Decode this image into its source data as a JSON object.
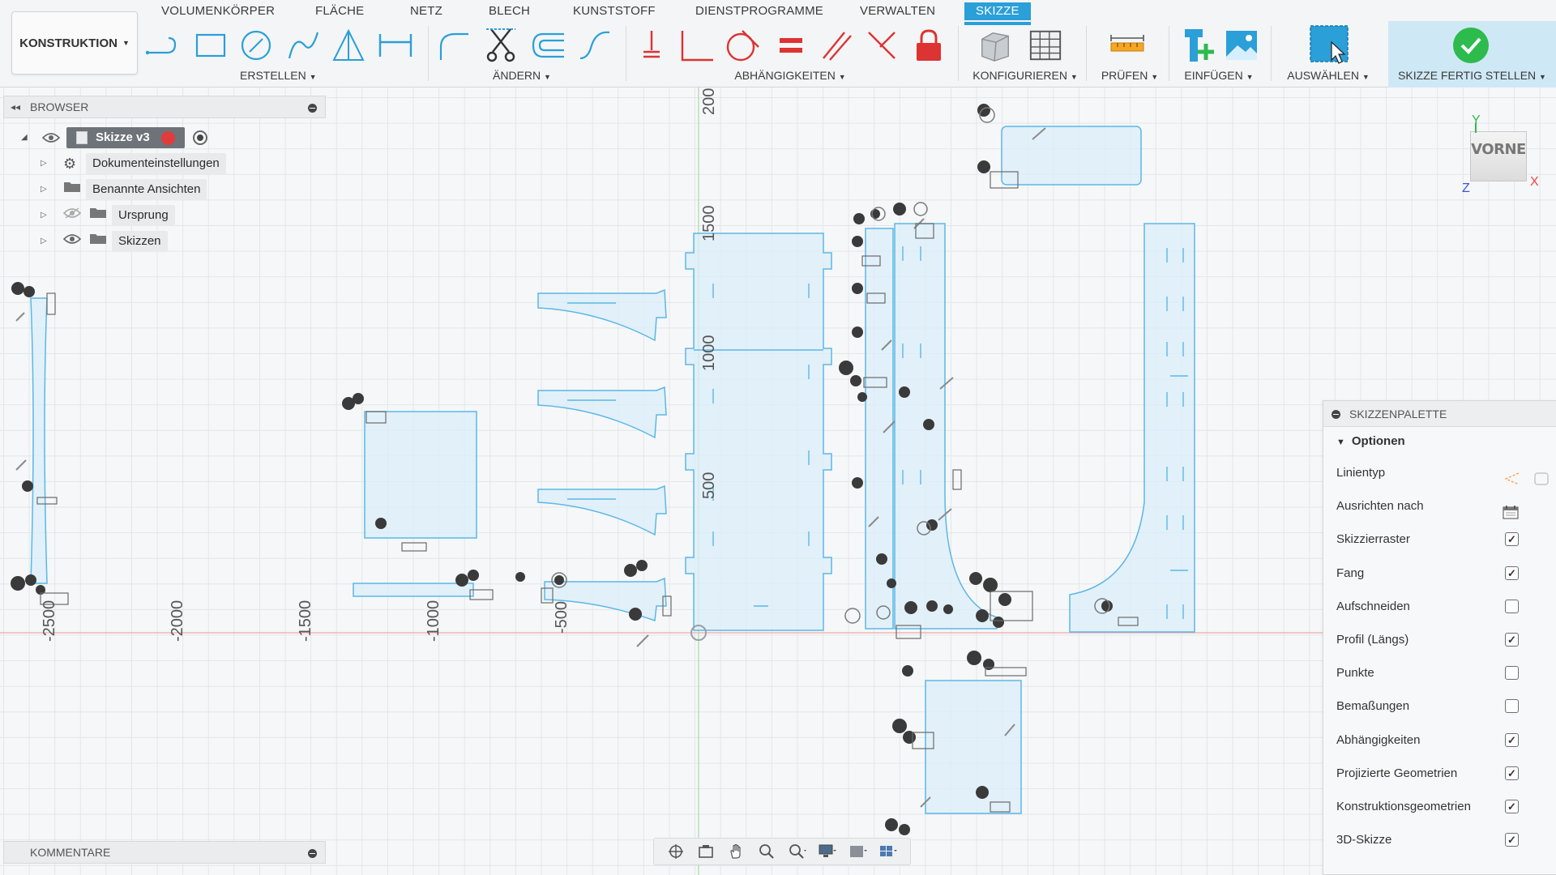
{
  "toolbar": {
    "workspace_label": "KONSTRUKTION",
    "tabs": [
      "VOLUMENKÖRPER",
      "FLÄCHE",
      "NETZ",
      "BLECH",
      "KUNSTSTOFF",
      "DIENSTPROGRAMME",
      "VERWALTEN",
      "SKIZZE"
    ],
    "active_tab": "SKIZZE",
    "groups": {
      "erstellen": "ERSTELLEN",
      "aendern": "ÄNDERN",
      "abhaengigkeiten": "ABHÄNGIGKEITEN",
      "konfigurieren": "KONFIGURIEREN",
      "pruefen": "PRÜFEN",
      "einfuegen": "EINFÜGEN",
      "auswaehlen": "AUSWÄHLEN",
      "fertig": "SKIZZE FERTIG STELLEN"
    },
    "accent_color": "#2a9fd8",
    "finish_color": "#2dbb4e"
  },
  "browser": {
    "title": "BROWSER",
    "sketch_name": "Skizze v3",
    "items": [
      {
        "label": "Dokumenteinstellungen",
        "icon": "gear-icon"
      },
      {
        "label": "Benannte Ansichten",
        "icon": "folder-icon"
      },
      {
        "label": "Ursprung",
        "icon": "folder-icon"
      },
      {
        "label": "Skizzen",
        "icon": "folder-icon"
      }
    ]
  },
  "comments": {
    "title": "KOMMENTARE"
  },
  "canvas": {
    "ruler_x": [
      "-2500",
      "-2000",
      "-1500",
      "-1000",
      "-500"
    ],
    "ruler_y": [
      "200",
      "1500",
      "1000",
      "500"
    ],
    "sketch_color": "#5bb8e6",
    "fill_color": "#dbeef9"
  },
  "viewcube": {
    "face": "VORNE",
    "axis_y": "Y",
    "axis_x": "X",
    "axis_z": "Z"
  },
  "palette": {
    "title": "SKIZZENPALETTE",
    "section": "Optionen",
    "options": [
      {
        "label": "Linientyp",
        "control": "icons",
        "checked": null
      },
      {
        "label": "Ausrichten nach",
        "control": "calendar-icon",
        "checked": null
      },
      {
        "label": "Skizzierraster",
        "control": "checkbox",
        "checked": true
      },
      {
        "label": "Fang",
        "control": "checkbox",
        "checked": true
      },
      {
        "label": "Aufschneiden",
        "control": "checkbox",
        "checked": false
      },
      {
        "label": "Profil (Längs)",
        "control": "checkbox",
        "checked": true
      },
      {
        "label": "Punkte",
        "control": "checkbox",
        "checked": false
      },
      {
        "label": "Bemaßungen",
        "control": "checkbox",
        "checked": false
      },
      {
        "label": "Abhängigkeiten",
        "control": "checkbox",
        "checked": true
      },
      {
        "label": "Projizierte Geometrien",
        "control": "checkbox",
        "checked": true
      },
      {
        "label": "Konstruktionsgeometrien",
        "control": "checkbox",
        "checked": true
      },
      {
        "label": "3D-Skizze",
        "control": "checkbox",
        "checked": true
      }
    ],
    "check_glyph": "✓"
  }
}
